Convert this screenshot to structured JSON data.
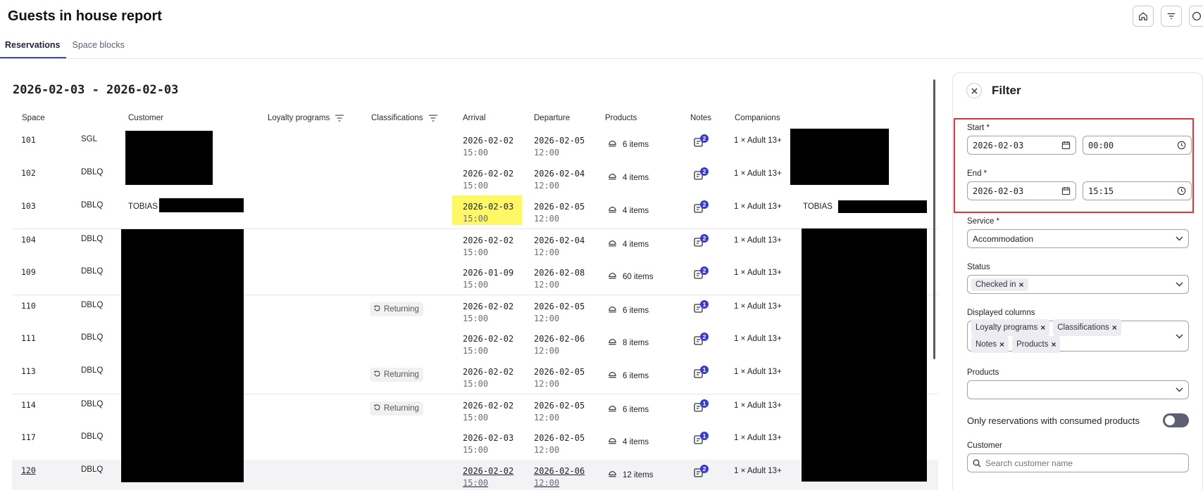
{
  "page": {
    "title": "Guests in house report"
  },
  "tabs": [
    {
      "label": "Reservations"
    },
    {
      "label": "Space blocks"
    }
  ],
  "range": "2026-02-03 - 2026-02-03",
  "table": {
    "headers": {
      "space": "Space",
      "customer": "Customer",
      "loyalty": "Loyalty programs",
      "classifications": "Classifications",
      "arrival": "Arrival",
      "departure": "Departure",
      "products": "Products",
      "notes": "Notes",
      "companions": "Companions"
    },
    "rows": [
      {
        "space": "101",
        "type": "SGL",
        "customer": "",
        "companion_name": "",
        "classification": "",
        "arr_d": "2026-02-02",
        "arr_t": "15:00",
        "dep_d": "2026-02-05",
        "dep_t": "12:00",
        "products": "6 items",
        "notes": "2",
        "companions": "1 × Adult 13+"
      },
      {
        "space": "102",
        "type": "DBLQ",
        "customer": "",
        "companion_name": "",
        "classification": "",
        "arr_d": "2026-02-02",
        "arr_t": "15:00",
        "dep_d": "2026-02-04",
        "dep_t": "12:00",
        "products": "4 items",
        "notes": "2",
        "companions": "1 × Adult 13+"
      },
      {
        "space": "103",
        "type": "DBLQ",
        "customer": "TOBIAS",
        "companion_name": "TOBIAS",
        "classification": "",
        "arr_d": "2026-02-03",
        "arr_t": "15:00",
        "dep_d": "2026-02-05",
        "dep_t": "12:00",
        "products": "4 items",
        "notes": "2",
        "companions": "1 × Adult 13+"
      },
      {
        "space": "104",
        "type": "DBLQ",
        "customer": "",
        "companion_name": "",
        "classification": "",
        "arr_d": "2026-02-02",
        "arr_t": "15:00",
        "dep_d": "2026-02-04",
        "dep_t": "12:00",
        "products": "4 items",
        "notes": "2",
        "companions": "1 × Adult 13+"
      },
      {
        "space": "109",
        "type": "DBLQ",
        "customer": "",
        "companion_name": "",
        "classification": "",
        "arr_d": "2026-01-09",
        "arr_t": "15:00",
        "dep_d": "2026-02-08",
        "dep_t": "12:00",
        "products": "60 items",
        "notes": "2",
        "companions": "1 × Adult 13+"
      },
      {
        "space": "110",
        "type": "DBLQ",
        "customer": "",
        "companion_name": "",
        "classification": "Returning",
        "arr_d": "2026-02-02",
        "arr_t": "15:00",
        "dep_d": "2026-02-05",
        "dep_t": "12:00",
        "products": "6 items",
        "notes": "1",
        "companions": "1 × Adult 13+"
      },
      {
        "space": "111",
        "type": "DBLQ",
        "customer": "",
        "companion_name": "",
        "classification": "",
        "arr_d": "2026-02-02",
        "arr_t": "15:00",
        "dep_d": "2026-02-06",
        "dep_t": "12:00",
        "products": "8 items",
        "notes": "2",
        "companions": "1 × Adult 13+"
      },
      {
        "space": "113",
        "type": "DBLQ",
        "customer": "",
        "companion_name": "",
        "classification": "Returning",
        "arr_d": "2026-02-02",
        "arr_t": "15:00",
        "dep_d": "2026-02-05",
        "dep_t": "12:00",
        "products": "6 items",
        "notes": "1",
        "companions": "1 × Adult 13+"
      },
      {
        "space": "114",
        "type": "DBLQ",
        "customer": "",
        "companion_name": "",
        "classification": "Returning",
        "arr_d": "2026-02-02",
        "arr_t": "15:00",
        "dep_d": "2026-02-05",
        "dep_t": "12:00",
        "products": "6 items",
        "notes": "1",
        "companions": "1 × Adult 13+"
      },
      {
        "space": "117",
        "type": "DBLQ",
        "customer": "",
        "companion_name": "",
        "classification": "",
        "arr_d": "2026-02-03",
        "arr_t": "15:00",
        "dep_d": "2026-02-05",
        "dep_t": "12:00",
        "products": "4 items",
        "notes": "1",
        "companions": "1 × Adult 13+"
      },
      {
        "space": "120",
        "type": "DBLQ",
        "customer": "",
        "companion_name": "",
        "classification": "",
        "arr_d": "2026-02-02",
        "arr_t": "15:00",
        "dep_d": "2026-02-06",
        "dep_t": "12:00",
        "products": "12 items",
        "notes": "2",
        "companions": "1 × Adult 13+"
      }
    ]
  },
  "filter": {
    "title": "Filter",
    "start": {
      "label": "Start *",
      "date": "2026-02-03",
      "time": "00:00"
    },
    "end": {
      "label": "End *",
      "date": "2026-02-03",
      "time": "15:15"
    },
    "service": {
      "label": "Service *",
      "value": "Accommodation"
    },
    "status": {
      "label": "Status",
      "chips": [
        "Checked in"
      ]
    },
    "columns": {
      "label": "Displayed columns",
      "chips": [
        "Loyalty programs",
        "Classifications",
        "Notes",
        "Products"
      ]
    },
    "products": {
      "label": "Products"
    },
    "consumed": {
      "label": "Only reservations with consumed products",
      "enabled": false
    },
    "customer": {
      "label": "Customer",
      "placeholder": "Search customer name"
    }
  },
  "colors": {
    "accent": "#3a45c8",
    "highlight": "#fff866",
    "annotation": "#d9363e",
    "badge": "#3a3ad0"
  }
}
